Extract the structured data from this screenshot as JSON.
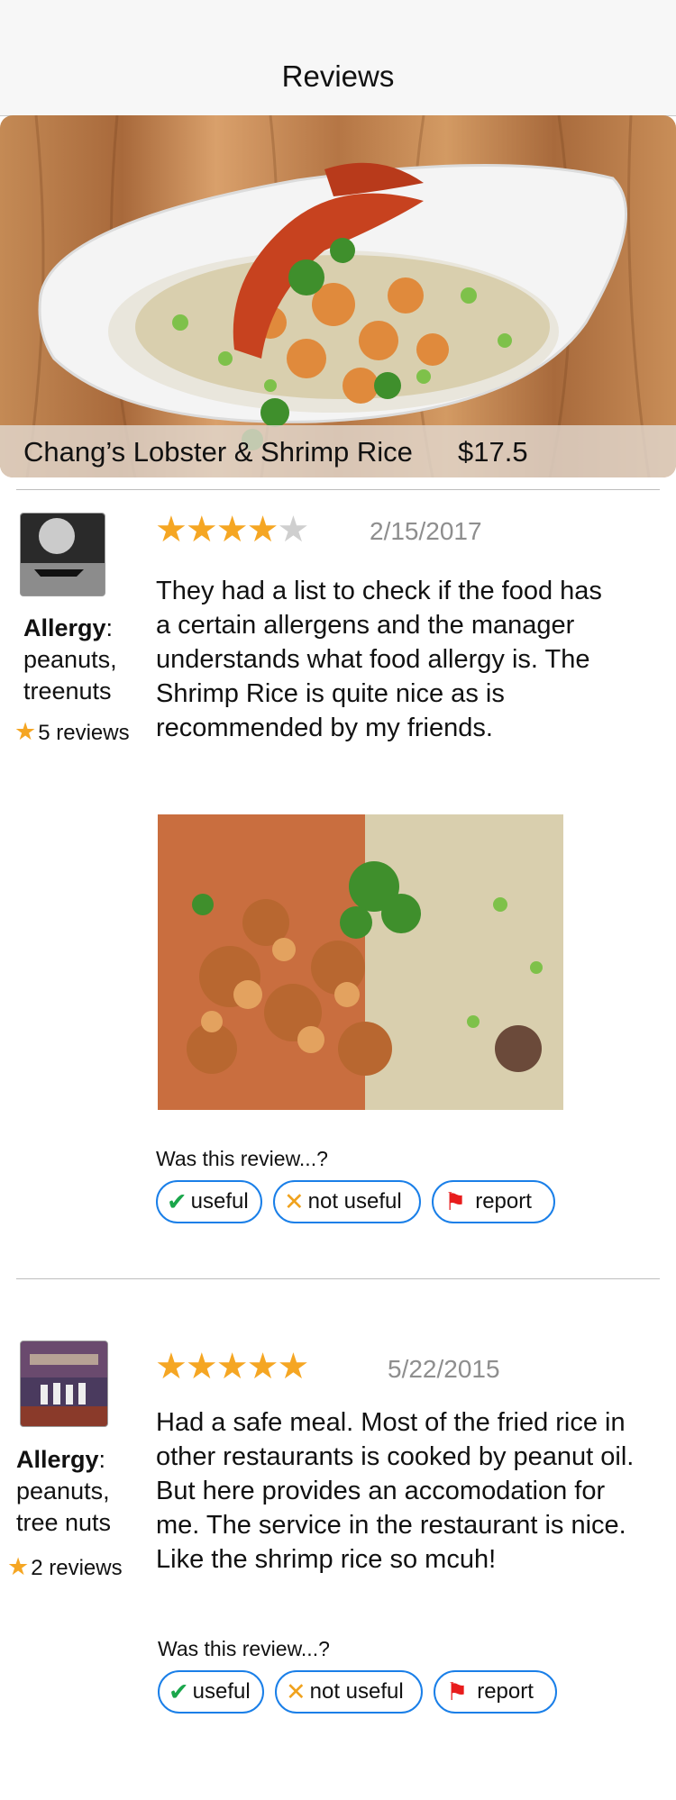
{
  "header": {
    "title": "Reviews"
  },
  "dish": {
    "name": "Chang’s Lobster & Shrimp Rice",
    "price": "$17.5"
  },
  "reviews": [
    {
      "rating": 4,
      "date": "2/15/2017",
      "allergy_label": "Allergy",
      "allergy_items": [
        "peanuts,",
        "treenuts"
      ],
      "review_count": "5 reviews",
      "text": "They had a list to check if the food has a certain allergens and the manager understands what food allergy is. The Shrimp Rice is quite nice as is recommended by my friends.",
      "has_photo": true,
      "feedback_question": "Was this review...?",
      "buttons": {
        "useful": "useful",
        "not_useful": "not useful",
        "report": "report"
      }
    },
    {
      "rating": 5,
      "date": "5/22/2015",
      "allergy_label": "Allergy",
      "allergy_items": [
        "peanuts,",
        "tree nuts"
      ],
      "review_count": "2 reviews",
      "text": "Had a safe meal. Most of the fried rice in other restaurants is cooked by peanut oil. But here provides an accomodation for me. The service in the restaurant is nice. Like the shrimp rice so mcuh!",
      "has_photo": false,
      "feedback_question": "Was this review...?",
      "buttons": {
        "useful": "useful",
        "not_useful": "not useful",
        "report": "report"
      }
    }
  ],
  "icons": {
    "useful": "checkmark-icon",
    "not_useful": "x-mark-icon",
    "report": "red-flag-icon",
    "rating": "star-icon"
  },
  "colors": {
    "star": "#f5a623",
    "star_empty": "#cfcfcf",
    "pill_border": "#1a7fe8",
    "check": "#1aa64b",
    "x": "#f0a21d",
    "flag": "#e81c1c"
  }
}
